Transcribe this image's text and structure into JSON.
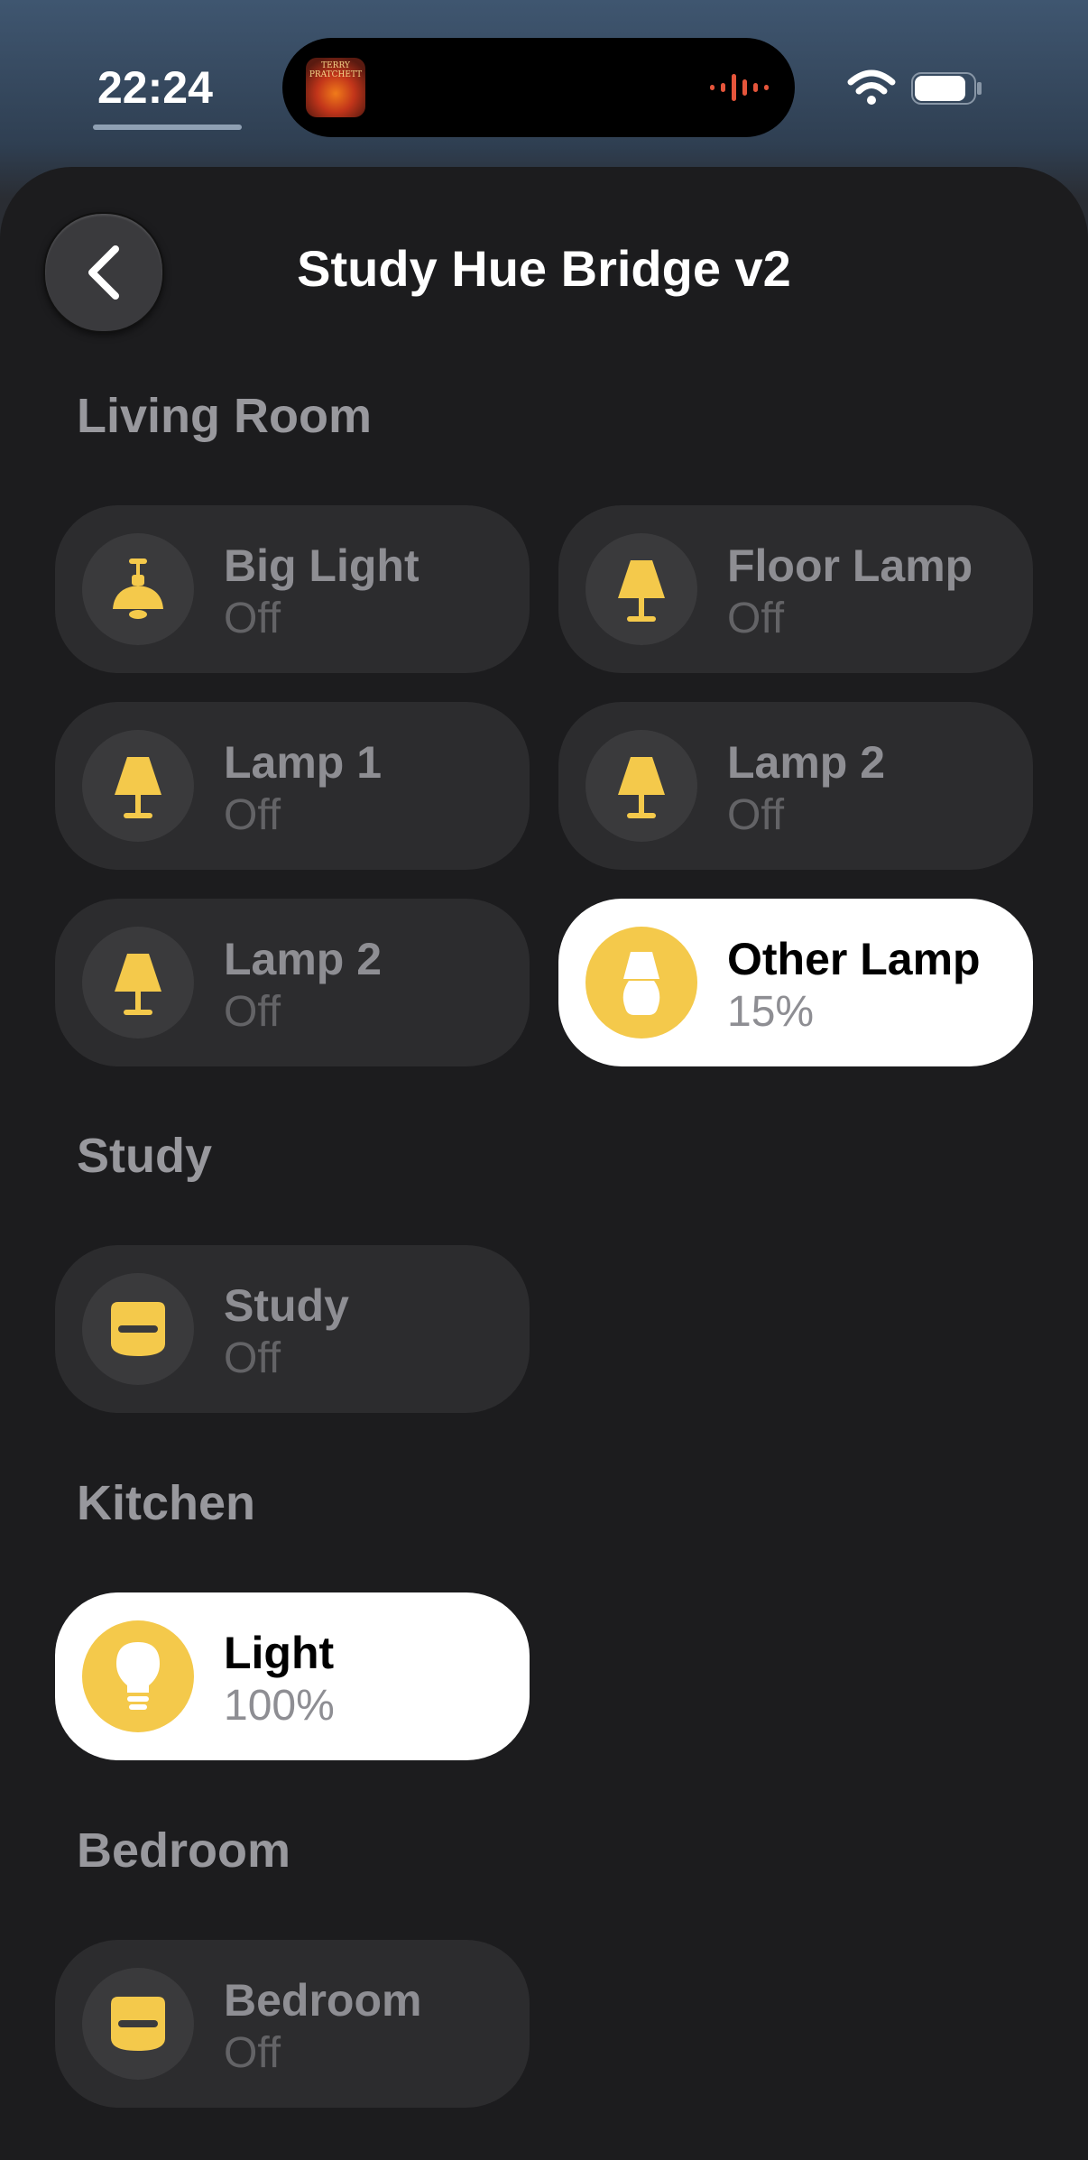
{
  "status_bar": {
    "time": "22:24",
    "album_art_text": "TERRY PRATCHETT"
  },
  "header": {
    "title": "Study Hue Bridge v2"
  },
  "colors": {
    "accent_yellow": "#f4c94b",
    "tile_off": "#2c2c2e",
    "tile_on": "#ffffff",
    "background": "#1c1c1e"
  },
  "sections": [
    {
      "title": "Living Room",
      "lights": [
        {
          "name": "Big Light",
          "state": "Off",
          "on": false,
          "icon": "pendant-lamp-icon"
        },
        {
          "name": "Floor Lamp",
          "state": "Off",
          "on": false,
          "icon": "table-lamp-icon"
        },
        {
          "name": "Lamp 1",
          "state": "Off",
          "on": false,
          "icon": "table-lamp-icon"
        },
        {
          "name": "Lamp 2",
          "state": "Off",
          "on": false,
          "icon": "table-lamp-icon"
        },
        {
          "name": "Lamp 2",
          "state": "Off",
          "on": false,
          "icon": "table-lamp-icon"
        },
        {
          "name": "Other Lamp",
          "state": "15%",
          "on": true,
          "icon": "bedside-lamp-icon"
        }
      ]
    },
    {
      "title": "Study",
      "lights": [
        {
          "name": "Study",
          "state": "Off",
          "on": false,
          "icon": "ceiling-spot-icon"
        }
      ]
    },
    {
      "title": "Kitchen",
      "lights": [
        {
          "name": "Light",
          "state": "100%",
          "on": true,
          "icon": "bulb-icon"
        }
      ]
    },
    {
      "title": "Bedroom",
      "lights": [
        {
          "name": "Bedroom",
          "state": "Off",
          "on": false,
          "icon": "ceiling-spot-icon"
        }
      ]
    }
  ]
}
